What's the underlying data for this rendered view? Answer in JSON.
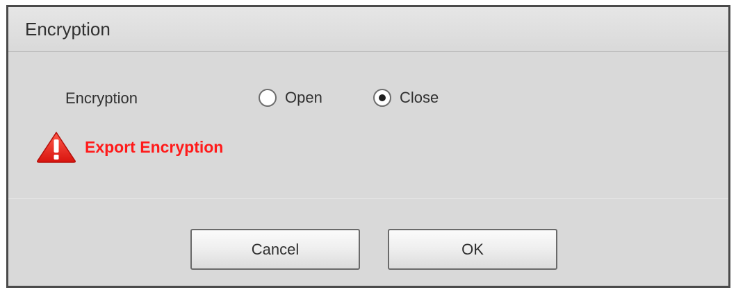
{
  "dialog": {
    "title": "Encryption"
  },
  "form": {
    "encryption_label": "Encryption",
    "options": [
      {
        "label": "Open",
        "selected": false
      },
      {
        "label": "Close",
        "selected": true
      }
    ]
  },
  "warning": {
    "icon": "warning-triangle-icon",
    "text": "Export Encryption",
    "color": "#ff1a1a"
  },
  "buttons": {
    "cancel_label": "Cancel",
    "ok_label": "OK"
  }
}
